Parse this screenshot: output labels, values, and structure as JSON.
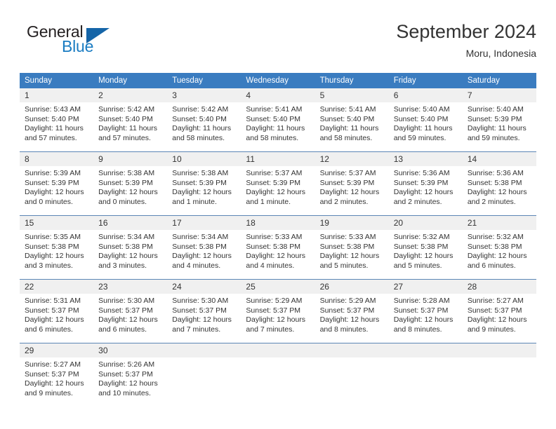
{
  "logo": {
    "word_top": "General",
    "word_bottom": "Blue",
    "triangle_color": "#1565a8",
    "blue_color": "#1a7cc2"
  },
  "header": {
    "title": "September 2024",
    "subtitle": "Moru, Indonesia"
  },
  "colors": {
    "header_row_background": "#3a7cc0",
    "header_row_text": "#ffffff",
    "daynum_background": "#f0f0f0",
    "row_separator": "#5b86b5",
    "body_text": "#333333"
  },
  "weekday_headers": [
    "Sunday",
    "Monday",
    "Tuesday",
    "Wednesday",
    "Thursday",
    "Friday",
    "Saturday"
  ],
  "weeks": [
    [
      {
        "day": "1",
        "sunrise": "Sunrise: 5:43 AM",
        "sunset": "Sunset: 5:40 PM",
        "daylight_line1": "Daylight: 11 hours",
        "daylight_line2": "and 57 minutes."
      },
      {
        "day": "2",
        "sunrise": "Sunrise: 5:42 AM",
        "sunset": "Sunset: 5:40 PM",
        "daylight_line1": "Daylight: 11 hours",
        "daylight_line2": "and 57 minutes."
      },
      {
        "day": "3",
        "sunrise": "Sunrise: 5:42 AM",
        "sunset": "Sunset: 5:40 PM",
        "daylight_line1": "Daylight: 11 hours",
        "daylight_line2": "and 58 minutes."
      },
      {
        "day": "4",
        "sunrise": "Sunrise: 5:41 AM",
        "sunset": "Sunset: 5:40 PM",
        "daylight_line1": "Daylight: 11 hours",
        "daylight_line2": "and 58 minutes."
      },
      {
        "day": "5",
        "sunrise": "Sunrise: 5:41 AM",
        "sunset": "Sunset: 5:40 PM",
        "daylight_line1": "Daylight: 11 hours",
        "daylight_line2": "and 58 minutes."
      },
      {
        "day": "6",
        "sunrise": "Sunrise: 5:40 AM",
        "sunset": "Sunset: 5:40 PM",
        "daylight_line1": "Daylight: 11 hours",
        "daylight_line2": "and 59 minutes."
      },
      {
        "day": "7",
        "sunrise": "Sunrise: 5:40 AM",
        "sunset": "Sunset: 5:39 PM",
        "daylight_line1": "Daylight: 11 hours",
        "daylight_line2": "and 59 minutes."
      }
    ],
    [
      {
        "day": "8",
        "sunrise": "Sunrise: 5:39 AM",
        "sunset": "Sunset: 5:39 PM",
        "daylight_line1": "Daylight: 12 hours",
        "daylight_line2": "and 0 minutes."
      },
      {
        "day": "9",
        "sunrise": "Sunrise: 5:38 AM",
        "sunset": "Sunset: 5:39 PM",
        "daylight_line1": "Daylight: 12 hours",
        "daylight_line2": "and 0 minutes."
      },
      {
        "day": "10",
        "sunrise": "Sunrise: 5:38 AM",
        "sunset": "Sunset: 5:39 PM",
        "daylight_line1": "Daylight: 12 hours",
        "daylight_line2": "and 1 minute."
      },
      {
        "day": "11",
        "sunrise": "Sunrise: 5:37 AM",
        "sunset": "Sunset: 5:39 PM",
        "daylight_line1": "Daylight: 12 hours",
        "daylight_line2": "and 1 minute."
      },
      {
        "day": "12",
        "sunrise": "Sunrise: 5:37 AM",
        "sunset": "Sunset: 5:39 PM",
        "daylight_line1": "Daylight: 12 hours",
        "daylight_line2": "and 2 minutes."
      },
      {
        "day": "13",
        "sunrise": "Sunrise: 5:36 AM",
        "sunset": "Sunset: 5:39 PM",
        "daylight_line1": "Daylight: 12 hours",
        "daylight_line2": "and 2 minutes."
      },
      {
        "day": "14",
        "sunrise": "Sunrise: 5:36 AM",
        "sunset": "Sunset: 5:38 PM",
        "daylight_line1": "Daylight: 12 hours",
        "daylight_line2": "and 2 minutes."
      }
    ],
    [
      {
        "day": "15",
        "sunrise": "Sunrise: 5:35 AM",
        "sunset": "Sunset: 5:38 PM",
        "daylight_line1": "Daylight: 12 hours",
        "daylight_line2": "and 3 minutes."
      },
      {
        "day": "16",
        "sunrise": "Sunrise: 5:34 AM",
        "sunset": "Sunset: 5:38 PM",
        "daylight_line1": "Daylight: 12 hours",
        "daylight_line2": "and 3 minutes."
      },
      {
        "day": "17",
        "sunrise": "Sunrise: 5:34 AM",
        "sunset": "Sunset: 5:38 PM",
        "daylight_line1": "Daylight: 12 hours",
        "daylight_line2": "and 4 minutes."
      },
      {
        "day": "18",
        "sunrise": "Sunrise: 5:33 AM",
        "sunset": "Sunset: 5:38 PM",
        "daylight_line1": "Daylight: 12 hours",
        "daylight_line2": "and 4 minutes."
      },
      {
        "day": "19",
        "sunrise": "Sunrise: 5:33 AM",
        "sunset": "Sunset: 5:38 PM",
        "daylight_line1": "Daylight: 12 hours",
        "daylight_line2": "and 5 minutes."
      },
      {
        "day": "20",
        "sunrise": "Sunrise: 5:32 AM",
        "sunset": "Sunset: 5:38 PM",
        "daylight_line1": "Daylight: 12 hours",
        "daylight_line2": "and 5 minutes."
      },
      {
        "day": "21",
        "sunrise": "Sunrise: 5:32 AM",
        "sunset": "Sunset: 5:38 PM",
        "daylight_line1": "Daylight: 12 hours",
        "daylight_line2": "and 6 minutes."
      }
    ],
    [
      {
        "day": "22",
        "sunrise": "Sunrise: 5:31 AM",
        "sunset": "Sunset: 5:37 PM",
        "daylight_line1": "Daylight: 12 hours",
        "daylight_line2": "and 6 minutes."
      },
      {
        "day": "23",
        "sunrise": "Sunrise: 5:30 AM",
        "sunset": "Sunset: 5:37 PM",
        "daylight_line1": "Daylight: 12 hours",
        "daylight_line2": "and 6 minutes."
      },
      {
        "day": "24",
        "sunrise": "Sunrise: 5:30 AM",
        "sunset": "Sunset: 5:37 PM",
        "daylight_line1": "Daylight: 12 hours",
        "daylight_line2": "and 7 minutes."
      },
      {
        "day": "25",
        "sunrise": "Sunrise: 5:29 AM",
        "sunset": "Sunset: 5:37 PM",
        "daylight_line1": "Daylight: 12 hours",
        "daylight_line2": "and 7 minutes."
      },
      {
        "day": "26",
        "sunrise": "Sunrise: 5:29 AM",
        "sunset": "Sunset: 5:37 PM",
        "daylight_line1": "Daylight: 12 hours",
        "daylight_line2": "and 8 minutes."
      },
      {
        "day": "27",
        "sunrise": "Sunrise: 5:28 AM",
        "sunset": "Sunset: 5:37 PM",
        "daylight_line1": "Daylight: 12 hours",
        "daylight_line2": "and 8 minutes."
      },
      {
        "day": "28",
        "sunrise": "Sunrise: 5:27 AM",
        "sunset": "Sunset: 5:37 PM",
        "daylight_line1": "Daylight: 12 hours",
        "daylight_line2": "and 9 minutes."
      }
    ],
    [
      {
        "day": "29",
        "sunrise": "Sunrise: 5:27 AM",
        "sunset": "Sunset: 5:37 PM",
        "daylight_line1": "Daylight: 12 hours",
        "daylight_line2": "and 9 minutes."
      },
      {
        "day": "30",
        "sunrise": "Sunrise: 5:26 AM",
        "sunset": "Sunset: 5:37 PM",
        "daylight_line1": "Daylight: 12 hours",
        "daylight_line2": "and 10 minutes."
      },
      {
        "day": "",
        "sunrise": "",
        "sunset": "",
        "daylight_line1": "",
        "daylight_line2": ""
      },
      {
        "day": "",
        "sunrise": "",
        "sunset": "",
        "daylight_line1": "",
        "daylight_line2": ""
      },
      {
        "day": "",
        "sunrise": "",
        "sunset": "",
        "daylight_line1": "",
        "daylight_line2": ""
      },
      {
        "day": "",
        "sunrise": "",
        "sunset": "",
        "daylight_line1": "",
        "daylight_line2": ""
      },
      {
        "day": "",
        "sunrise": "",
        "sunset": "",
        "daylight_line1": "",
        "daylight_line2": ""
      }
    ]
  ]
}
